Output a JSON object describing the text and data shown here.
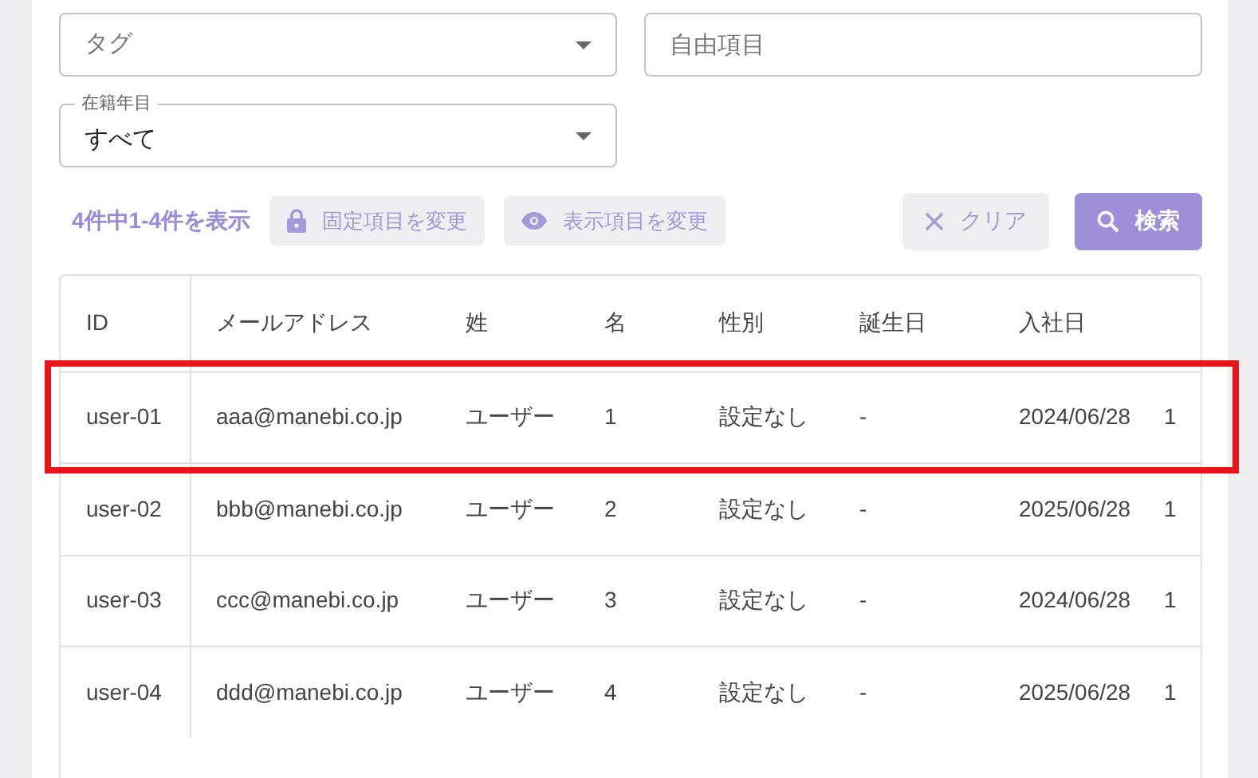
{
  "filters": [
    {
      "kind": "select",
      "placeholder": "タグ"
    },
    {
      "kind": "text",
      "placeholder": "自由項目"
    },
    {
      "kind": "select",
      "label": "在籍年目",
      "value": "すべて"
    }
  ],
  "result_count": "4件中1-4件を表示",
  "toolbar_buttons": [
    {
      "kind": "lock",
      "label": "固定項目を変更"
    },
    {
      "kind": "eye",
      "label": "表示項目を変更"
    }
  ],
  "clear_button": "クリア",
  "search_button": "検索",
  "table": {
    "columns": [
      "ID",
      "メールアドレス",
      "姓",
      "名",
      "性別",
      "誕生日",
      "入社日"
    ],
    "rows": [
      {
        "highlighted": true,
        "cells": [
          "user-01",
          "aaa@manebi.co.jp",
          "ユーザー",
          "1",
          "設定なし",
          "-",
          "2024/06/28",
          "1"
        ]
      },
      {
        "highlighted": false,
        "cells": [
          "user-02",
          "bbb@manebi.co.jp",
          "ユーザー",
          "2",
          "設定なし",
          "-",
          "2025/06/28",
          "1"
        ]
      },
      {
        "highlighted": false,
        "cells": [
          "user-03",
          "ccc@manebi.co.jp",
          "ユーザー",
          "3",
          "設定なし",
          "-",
          "2024/06/28",
          "1"
        ]
      },
      {
        "highlighted": false,
        "cells": [
          "user-04",
          "ddd@manebi.co.jp",
          "ユーザー",
          "4",
          "設定なし",
          "-",
          "2025/06/28",
          "1"
        ]
      }
    ]
  }
}
